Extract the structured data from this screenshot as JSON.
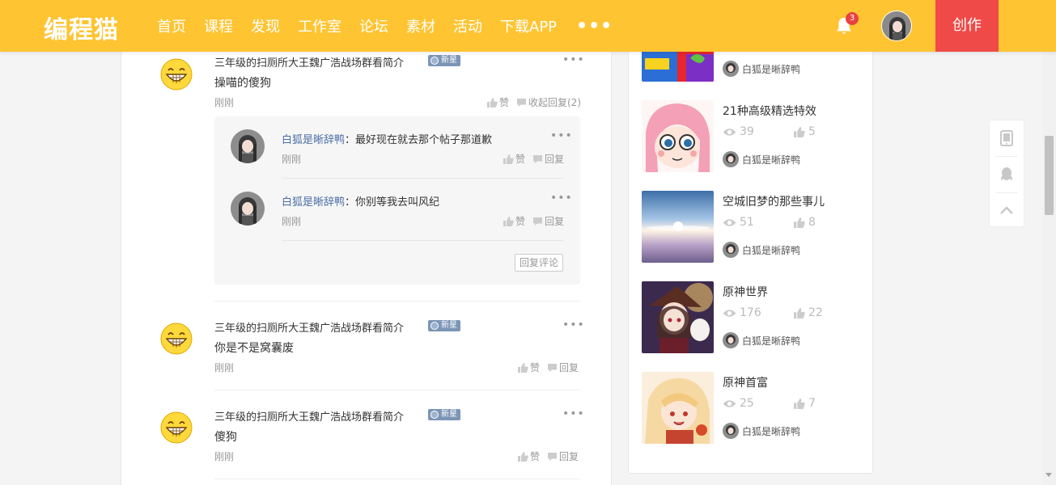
{
  "topbar": {
    "logo": "编程猫",
    "nav": [
      "首页",
      "课程",
      "发现",
      "工作室",
      "论坛",
      "素材",
      "活动",
      "下载APP"
    ],
    "more": "•••",
    "notification_count": "3",
    "create_label": "创作",
    "brand_color": "#ffc431",
    "create_color": "#ef4a48"
  },
  "comments": [
    {
      "author": "三年级的扫厕所大王魏广浩战场群看简介",
      "badge": "新星",
      "text": "操喵的傻狗",
      "time": "刚刚",
      "like_label": "赞",
      "reply_label": "收起回复(2)",
      "more": "•••",
      "replies": [
        {
          "author": "白狐是晰辞鸭",
          "text": "：最好现在就去那个帖子那道歉",
          "time": "刚刚",
          "like_label": "赞",
          "reply_label": "回复",
          "more": "•••"
        },
        {
          "author": "白狐是晰辞鸭",
          "text": "：你别等我去叫风纪",
          "time": "刚刚",
          "like_label": "赞",
          "reply_label": "回复",
          "more": "•••"
        }
      ],
      "reply_comment_button": "回复评论"
    },
    {
      "author": "三年级的扫厕所大王魏广浩战场群看简介",
      "badge": "新星",
      "text": "你是不是窝囊废",
      "time": "刚刚",
      "like_label": "赞",
      "reply_label": "回复",
      "more": "•••"
    },
    {
      "author": "三年级的扫厕所大王魏广浩战场群看简介",
      "badge": "新星",
      "text": "傻狗",
      "time": "刚刚",
      "like_label": "赞",
      "reply_label": "回复",
      "more": "•••"
    }
  ],
  "works": [
    {
      "title": "",
      "views": "",
      "likes": "",
      "author": "白狐是晰辞鸭"
    },
    {
      "title": "21种高级精选特效",
      "views": "39",
      "likes": "5",
      "author": "白狐是晰辞鸭"
    },
    {
      "title": "空城旧梦的那些事儿",
      "views": "51",
      "likes": "8",
      "author": "白狐是晰辞鸭"
    },
    {
      "title": "原神世界",
      "views": "176",
      "likes": "22",
      "author": "白狐是晰辞鸭"
    },
    {
      "title": "原神首富",
      "views": "25",
      "likes": "7",
      "author": "白狐是晰辞鸭"
    }
  ],
  "float_tools": [
    "phone-icon",
    "qq-icon",
    "back-to-top-icon"
  ]
}
